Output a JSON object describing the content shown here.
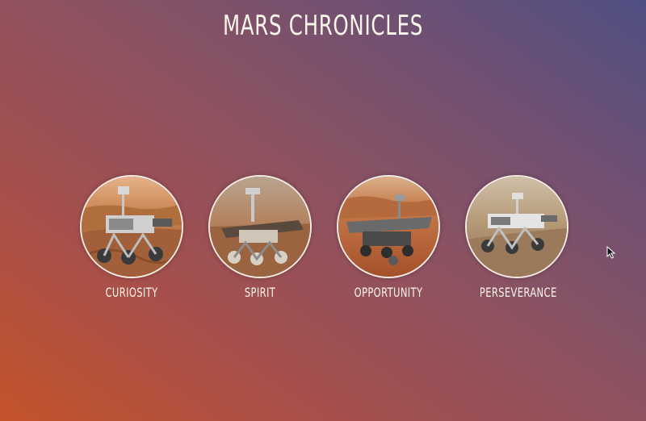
{
  "page": {
    "title": "MARS CHRONICLES"
  },
  "rovers": [
    {
      "label": "CURIOSITY"
    },
    {
      "label": "SPIRIT"
    },
    {
      "label": "OPPORTUNITY"
    },
    {
      "label": "PERSEVERANCE"
    }
  ],
  "icons": {
    "cursor": "mouse-pointer-icon"
  },
  "colors": {
    "text": "#fbf6ea",
    "gradient_start": "#c4532a",
    "gradient_end": "#4f4f83"
  }
}
